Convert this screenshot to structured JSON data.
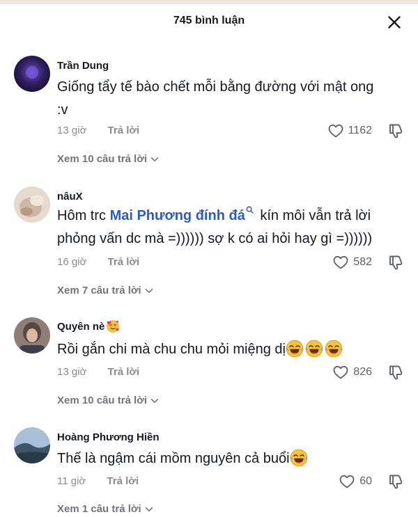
{
  "header": {
    "title": "745 bình luận",
    "close_icon": "close-icon"
  },
  "comments": [
    {
      "author": "Trần Dung",
      "text": "Giống tẩy tế bào chết mỗi bằng đường với mật ong :v",
      "time": "13 giờ",
      "reply_label": "Trả lời",
      "likes": "1162",
      "view_replies": "Xem 10 câu trả lời",
      "avatar_color": "#2a1f5e"
    },
    {
      "author": "nâuX",
      "text_before": "Hôm trc ",
      "mention": "Mai Phương đính đá",
      "text_after": " kín môi vẫn trả lời",
      "text_line2": "phỏng vấn dc mà =)))))) sợ k có ai hỏi hay gì =))))))",
      "time": "16 giờ",
      "reply_label": "Trả lời",
      "likes": "582",
      "view_replies": "Xem 7 câu trả lời",
      "avatar_color": "#d9c9bb"
    },
    {
      "author": "Quyên nè",
      "author_emoji": "smiling-face-with-hearts",
      "text": "Rồi gắn chi mà chu chu mỏi miệng dị",
      "text_emoji": "face-with-tears-of-joy",
      "time": "13 giờ",
      "reply_label": "Trả lời",
      "likes": "826",
      "view_replies": "Xem 10 câu trả lời",
      "avatar_color": "#7a6b66"
    },
    {
      "author": "Hoàng Phương Hiền",
      "text": "Thế là ngậm cái mồm nguyên cả buổi",
      "text_emoji": "face-with-tears-of-joy",
      "time": "11 giờ",
      "reply_label": "Trả lời",
      "likes": "60",
      "view_replies": "Xem 1 câu trả lời",
      "avatar_color": "#6f8aa0"
    }
  ],
  "colors": {
    "text_primary": "#161823",
    "text_secondary": "#8a8b91",
    "mention": "#2b5db9",
    "background": "#ffffff"
  }
}
